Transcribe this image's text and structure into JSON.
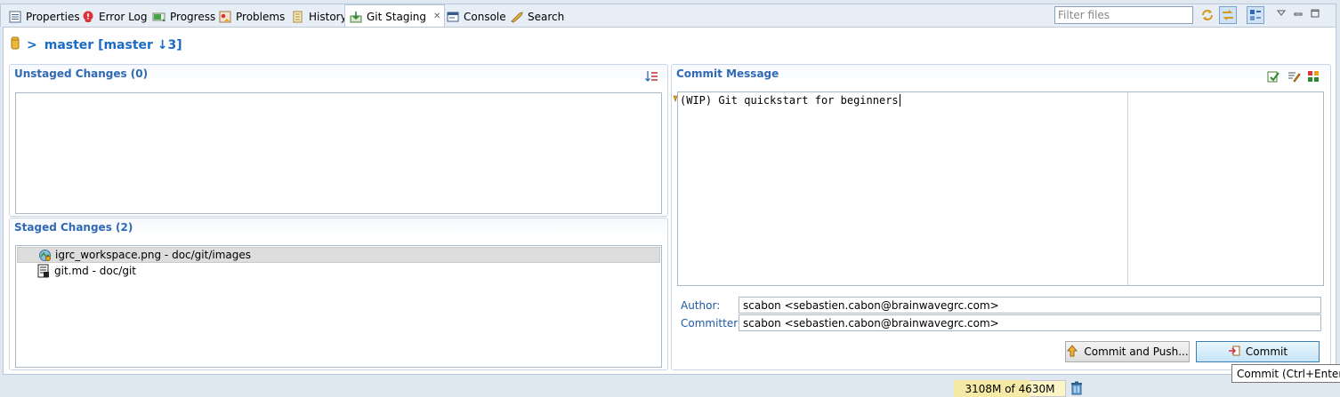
{
  "tabs": [
    {
      "label": "Properties",
      "icon": "properties-icon"
    },
    {
      "label": "Error Log",
      "icon": "error-log-icon"
    },
    {
      "label": "Progress",
      "icon": "progress-icon"
    },
    {
      "label": "Problems",
      "icon": "problems-icon"
    },
    {
      "label": "History",
      "icon": "history-icon"
    },
    {
      "label": "Git Staging",
      "icon": "git-staging-icon",
      "active": true
    },
    {
      "label": "Console",
      "icon": "console-icon"
    },
    {
      "label": "Search",
      "icon": "search-icon"
    }
  ],
  "toolbar": {
    "filter_placeholder": "Filter files",
    "filter_value": ""
  },
  "repo": {
    "prefix": ">",
    "label": "master [master ↓3]"
  },
  "unstaged": {
    "title": "Unstaged Changes (0)",
    "files": []
  },
  "staged": {
    "title": "Staged Changes (2)",
    "files": [
      {
        "name": "igrc_workspace.png - doc/git/images",
        "icon": "image-file-icon",
        "selected": true
      },
      {
        "name": "git.md - doc/git",
        "icon": "text-file-icon",
        "selected": false
      }
    ]
  },
  "commit": {
    "title": "Commit Message",
    "message": "(WIP) Git quickstart for beginners",
    "author_label": "Author:",
    "author": "scabon <sebastien.cabon@brainwavegrc.com>",
    "committer_label": "Committer:",
    "committer": "scabon <sebastien.cabon@brainwavegrc.com>",
    "commit_push_label": "Commit and Push...",
    "commit_label": "Commit",
    "tooltip": "Commit (Ctrl+Enter)"
  },
  "status": {
    "heap": "3108M of 4630M",
    "heap_used_fraction": 0.671
  },
  "colors": {
    "accent": "#1b6bc6",
    "section_title": "#2f69b5",
    "view_background": "#dfe8f1"
  }
}
